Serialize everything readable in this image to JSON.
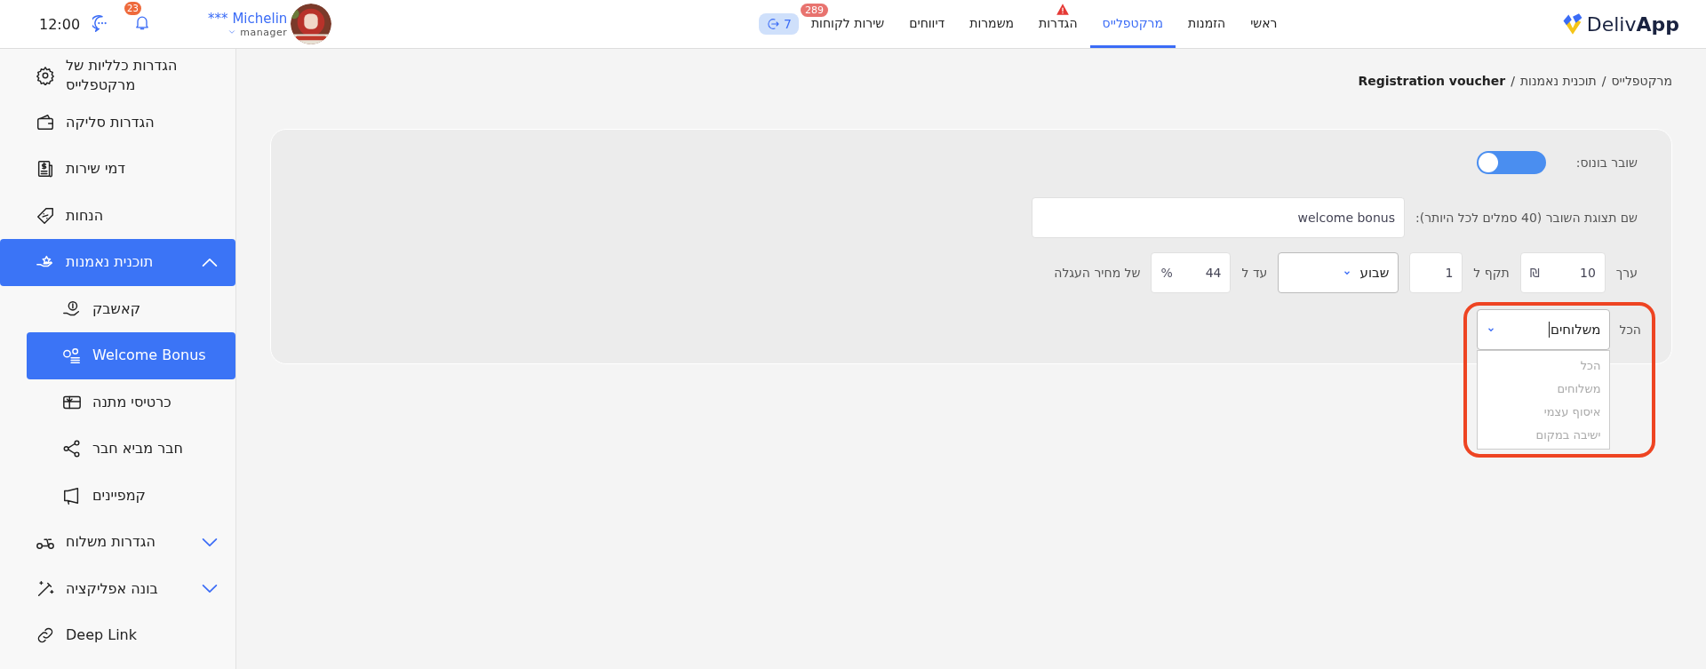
{
  "header": {
    "time": "12:00",
    "notifications": "23",
    "user": {
      "name": "*** Michelin",
      "role": "manager"
    },
    "service_chip": "7",
    "nav": [
      {
        "label": "ראשי",
        "selected": false,
        "alert": false
      },
      {
        "label": "הזמנות",
        "selected": false,
        "alert": false
      },
      {
        "label": "מרקטפלייס",
        "selected": true,
        "alert": false
      },
      {
        "label": "הגדרות",
        "selected": false,
        "alert": true
      },
      {
        "label": "משמרות",
        "selected": false,
        "alert": false
      },
      {
        "label": "דיווחים",
        "selected": false,
        "alert": false
      },
      {
        "label": "שירות לקוחות",
        "badge": "289",
        "selected": false,
        "alert": false
      }
    ],
    "logo": "Deliv**App**"
  },
  "sidebar": {
    "items": [
      {
        "label": "הגדרות כלליות של מרקטפלייס",
        "selected": false
      },
      {
        "label": "הגדרות סליקה",
        "selected": false
      },
      {
        "label": "דמי שירות",
        "selected": false
      },
      {
        "label": "הנחות",
        "selected": false
      },
      {
        "label": "תוכנית נאמנות",
        "selected": true,
        "expanded": true,
        "children": [
          {
            "label": "קאשבק",
            "selected": false
          },
          {
            "label": "Welcome Bonus",
            "selected": true
          },
          {
            "label": "כרטיסי מתנה",
            "selected": false
          },
          {
            "label": "חבר מביא חבר",
            "selected": false
          },
          {
            "label": "קמפיינים",
            "selected": false
          }
        ]
      },
      {
        "label": "הגדרות משלוח",
        "selected": false,
        "expanded": false
      },
      {
        "label": "בונה אפליקציה",
        "selected": false,
        "expanded": false
      },
      {
        "label": "Deep Link",
        "selected": false
      }
    ]
  },
  "breadcrumb": {
    "items": [
      "מרקטפלייס",
      "תוכנית נאמנות",
      "Registration voucher"
    ],
    "separator": "/"
  },
  "form": {
    "toggle": {
      "label": "שובר בונוס:",
      "on": true
    },
    "name": {
      "label": "שם תצוגת השובר (40 סמלים לכל היותר):",
      "value": "welcome bonus"
    },
    "value_row": {
      "value_label": "ערך",
      "value": "10",
      "currency": "₪",
      "valid_label": "תקף ל",
      "valid": "1",
      "period": "שבוע",
      "upto_label": "עד ל",
      "upto": "44",
      "percent": "%",
      "suffix": "של מחיר העגלה"
    },
    "scope": {
      "label": "הכל",
      "value": "משלוחים",
      "open": true,
      "options": [
        "הכל",
        "משלוחים",
        "איסוף עצמי",
        "ישיבה במקום"
      ]
    }
  }
}
